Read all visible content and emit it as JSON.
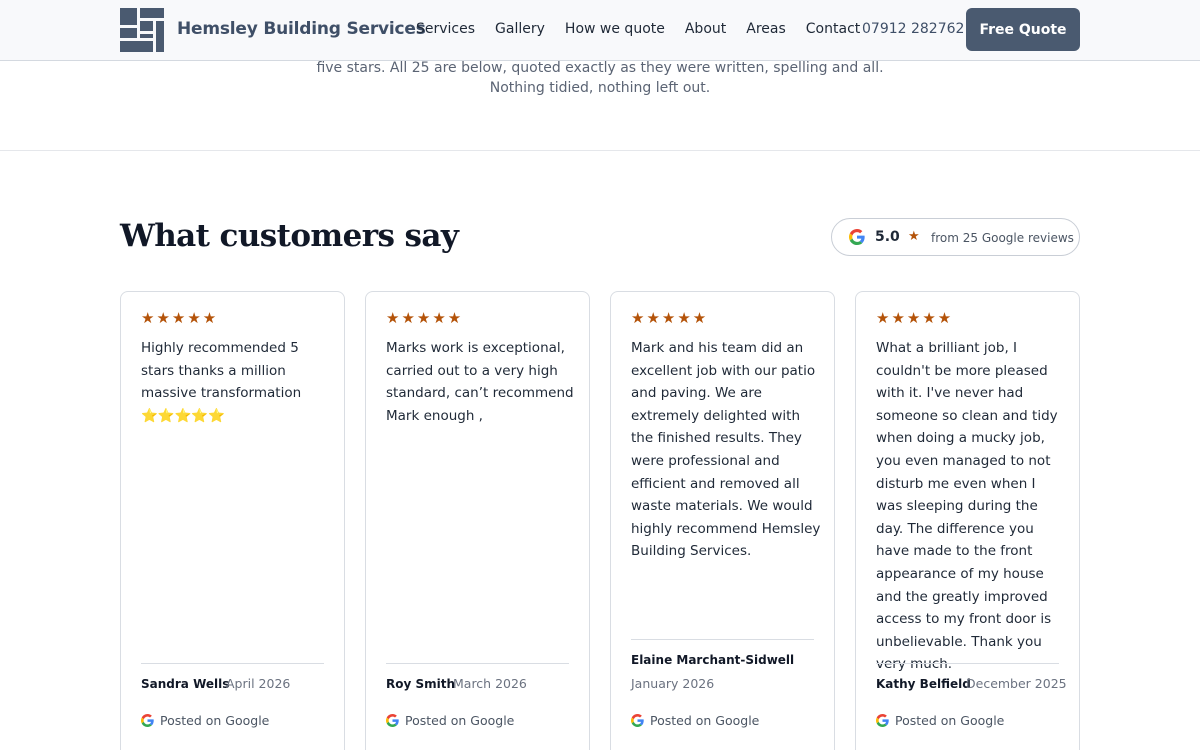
{
  "header": {
    "brand": "Hemsley Building Services",
    "nav": [
      "Services",
      "Gallery",
      "How we quote",
      "About",
      "Areas",
      "Contact"
    ],
    "phone": "07912 282762",
    "cta_label": "Free Quote"
  },
  "intro": {
    "line1": "five stars. All 25 are below, quoted exactly as they were written, spelling and all.",
    "line2": "Nothing tidied, nothing left out."
  },
  "section": {
    "title": "What customers say",
    "rating_value": "5.0",
    "rating_star": "★",
    "rating_count": "from 25 Google reviews"
  },
  "reviews": [
    {
      "stars": "★★★★★",
      "text": "Highly recommended 5 stars thanks a million massive transformation ⭐⭐⭐⭐⭐",
      "author": "Sandra Wells",
      "date": "April 2026",
      "posted": "Posted on Google"
    },
    {
      "stars": "★★★★★",
      "text": "Marks work is exceptional, carried out to a very high standard, can’t recommend Mark enough ,",
      "author": "Roy Smith",
      "date": "March 2026",
      "posted": "Posted on Google"
    },
    {
      "stars": "★★★★★",
      "text": "Mark and his team did an excellent job with our patio and paving. We are extremely delighted with the finished results. They were professional and efficient and removed all waste materials. We would highly recommend Hemsley Building Services.",
      "author": "Elaine Marchant-Sidwell",
      "date": "January 2026",
      "posted": "Posted on Google"
    },
    {
      "stars": "★★★★★",
      "text": "What a brilliant job, I couldn't be more pleased with it. I've never had someone so clean and tidy when doing a mucky job, you even managed to not disturb me even when I was sleeping during the day. The difference you have made to the front appearance of my house and the greatly improved access to my front door is unbelievable. Thank you very much.",
      "author": "Kathy Belfield",
      "date": "December 2025",
      "posted": "Posted on Google"
    }
  ]
}
